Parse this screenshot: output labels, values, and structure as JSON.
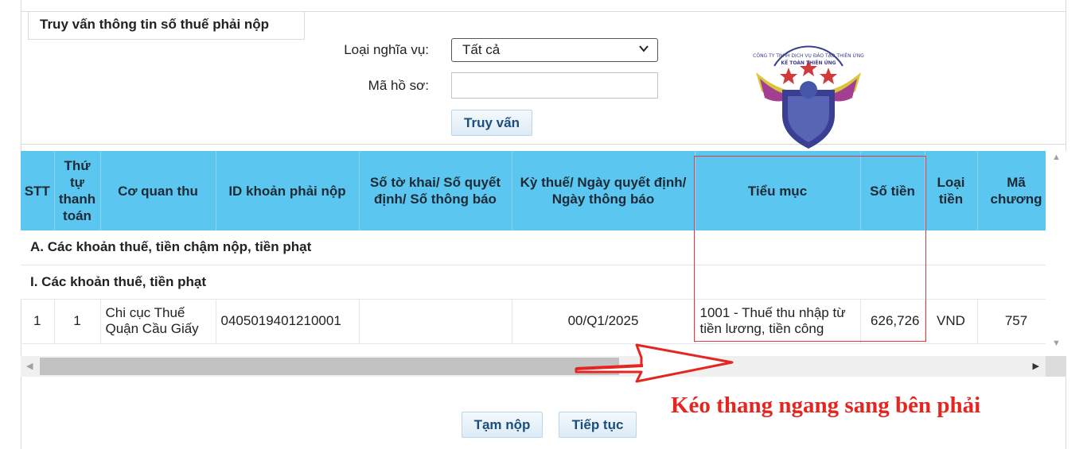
{
  "form": {
    "title": "Truy vấn thông tin số thuế phải nộp",
    "obligation_label": "Loại nghĩa vụ:",
    "obligation_value": "Tất cả",
    "record_label": "Mã hồ sơ:",
    "record_value": "",
    "query_button": "Truy vấn"
  },
  "logo": {
    "text_top": "CÔNG TY TNHH DỊCH VỤ ĐÀO TẠO THIÊN ỨNG",
    "text_bottom": "KẾ TOÁN THIÊN ỨNG"
  },
  "table": {
    "headers": [
      "STT",
      "Thứ tự thanh toán",
      "Cơ quan thu",
      "ID khoản phải nộp",
      "Số tờ khai/ Số quyết định/ Số thông báo",
      "Kỳ thuế/ Ngày quyết định/ Ngày thông báo",
      "Tiểu mục",
      "Số tiền",
      "Loại tiền",
      "Mã chương"
    ],
    "section_a": "A. Các khoản thuế, tiền chậm nộp, tiền phạt",
    "section_i": "I. Các khoản thuế, tiền phạt",
    "rows": [
      {
        "stt": "1",
        "order": "1",
        "agency": "Chi cục Thuế Quận Cầu Giấy",
        "id": "0405019401210001",
        "doc_no": "",
        "period": "00/Q1/2025",
        "subitem": "1001 - Thuế thu nhập từ tiền lương, tiền công",
        "amount": "626,726",
        "currency": "VND",
        "chapter": "757"
      }
    ]
  },
  "footer": {
    "temp_submit": "Tạm nộp",
    "continue": "Tiếp tục"
  },
  "annotation": {
    "hint": "Kéo thang ngang sang bên phải",
    "color": "#e52620"
  }
}
